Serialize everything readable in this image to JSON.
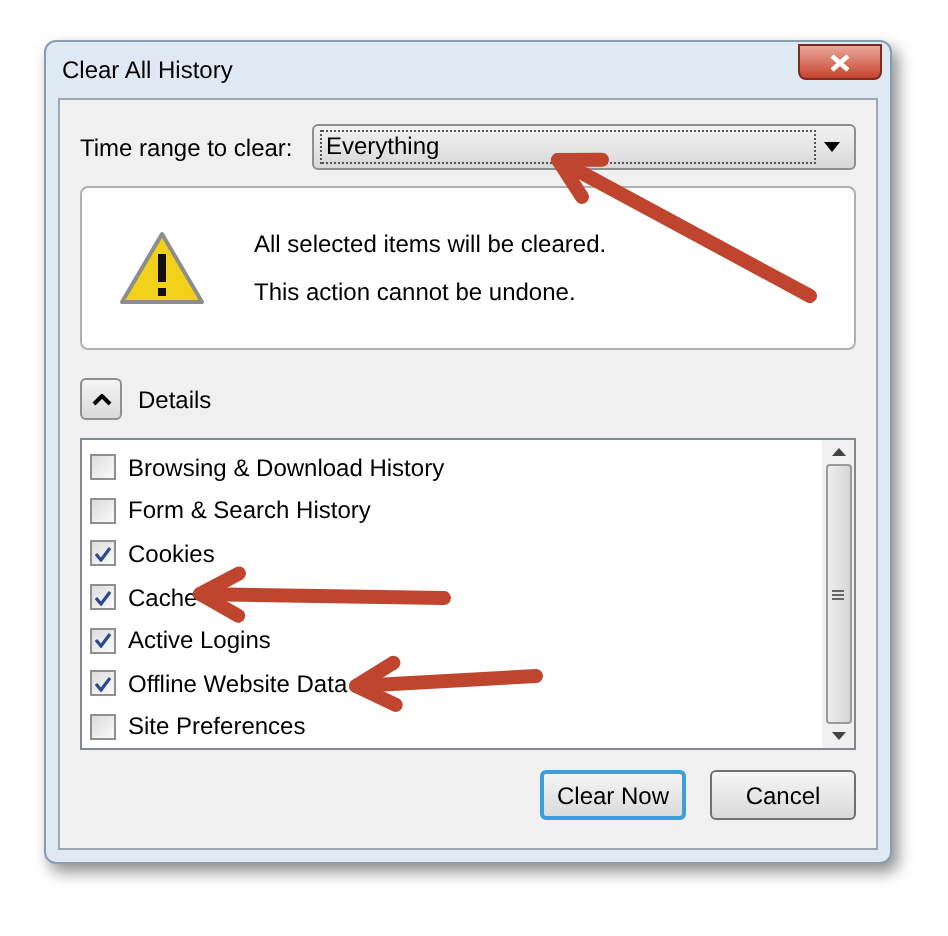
{
  "window": {
    "title": "Clear All History"
  },
  "time_range": {
    "label": "Time range to clear:",
    "value": "Everything"
  },
  "warning": {
    "lines": [
      "All selected items will be cleared.",
      "This action cannot be undone."
    ]
  },
  "details": {
    "label": "Details",
    "expanded": true
  },
  "items": [
    {
      "label": "Browsing & Download History",
      "checked": false
    },
    {
      "label": "Form & Search History",
      "checked": false
    },
    {
      "label": "Cookies",
      "checked": true
    },
    {
      "label": "Cache",
      "checked": true
    },
    {
      "label": "Active Logins",
      "checked": true
    },
    {
      "label": "Offline Website Data",
      "checked": true
    },
    {
      "label": "Site Preferences",
      "checked": false
    }
  ],
  "buttons": [
    {
      "label": "Clear Now",
      "default": true
    },
    {
      "label": "Cancel",
      "default": false
    }
  ]
}
